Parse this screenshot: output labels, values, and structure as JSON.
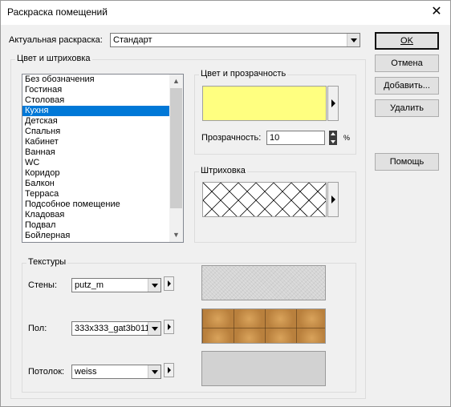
{
  "window": {
    "title": "Раскраска помещений",
    "close_glyph": "✕"
  },
  "current": {
    "label": "Актуальная раскраска:",
    "value": "Стандарт"
  },
  "buttons": {
    "ok": "OK",
    "cancel": "Отмена",
    "add": "Добавить...",
    "delete": "Удалить",
    "help": "Помощь"
  },
  "color_hatch_group": {
    "title": "Цвет и штриховка",
    "rooms": [
      "Без обозначения",
      "Гостиная",
      "Столовая",
      "Кухня",
      "Детская",
      "Спальня",
      "Кабинет",
      "Ванная",
      "WC",
      "Коридор",
      "Балкон",
      "Терраса",
      "Подсобное помещение",
      "Кладовая",
      "Подвал",
      "Бойлерная"
    ],
    "selected_index": 3
  },
  "color_group": {
    "title": "Цвет и прозрачность",
    "swatch_color": "#ffff80",
    "transparency_label": "Прозрачность:",
    "transparency_value": "10",
    "unit": "%"
  },
  "hatch_group": {
    "title": "Штриховка",
    "pattern": "diagonal-cross"
  },
  "textures_group": {
    "title": "Текстуры",
    "walls_label": "Стены:",
    "walls_value": "putz_m",
    "floor_label": "Пол:",
    "floor_value": "333x333_gat3b011",
    "ceiling_label": "Потолок:",
    "ceiling_value": "weiss"
  },
  "colors": {
    "selection": "#0078d7",
    "dialog_bg": "#f0f0f0"
  }
}
